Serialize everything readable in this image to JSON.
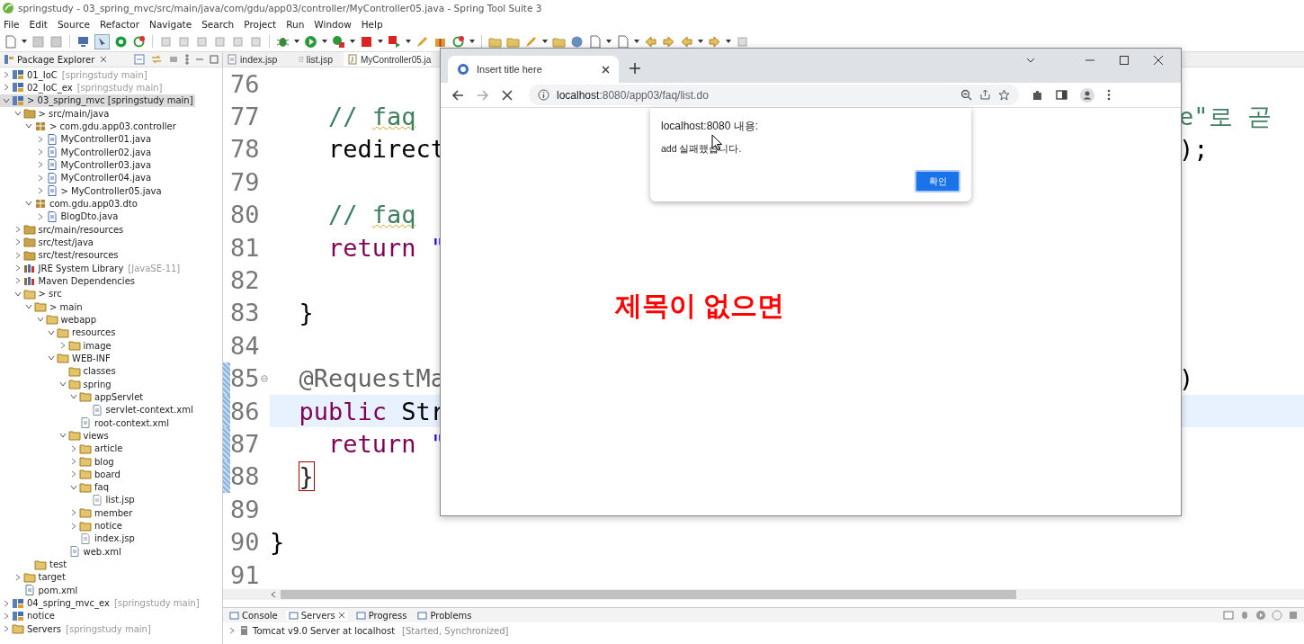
{
  "window": {
    "title": "springstudy - 03_spring_mvc/src/main/java/com/gdu/app03/controller/MyController05.java - Spring Tool Suite 3"
  },
  "menu": [
    "File",
    "Edit",
    "Source",
    "Refactor",
    "Navigate",
    "Search",
    "Project",
    "Run",
    "Window",
    "Help"
  ],
  "explorer": {
    "title": "Package Explorer",
    "tree": [
      {
        "label": "01_IoC",
        "tag": "[springstudy main]",
        "kind": "project",
        "expandable": true,
        "expanded": false,
        "selected": false
      },
      {
        "label": "02_IoC_ex",
        "tag": "[springstudy main]",
        "kind": "project",
        "expandable": true,
        "expanded": false,
        "selected": false
      },
      {
        "label": "> 03_spring_mvc [springstudy main]",
        "kind": "project",
        "expandable": true,
        "expanded": true,
        "selected": true,
        "children": [
          {
            "label": "> src/main/java",
            "kind": "source-folder",
            "expandable": true,
            "expanded": true,
            "selected": false,
            "children": [
              {
                "label": "> com.gdu.app03.controller",
                "kind": "package",
                "expandable": true,
                "expanded": true,
                "selected": false,
                "children": [
                  {
                    "label": "MyController01.java",
                    "kind": "java-file",
                    "expandable": true,
                    "expanded": false,
                    "selected": false
                  },
                  {
                    "label": "MyController02.java",
                    "kind": "java-file",
                    "expandable": true,
                    "expanded": false,
                    "selected": false
                  },
                  {
                    "label": "MyController03.java",
                    "kind": "java-file",
                    "expandable": true,
                    "expanded": false,
                    "selected": false
                  },
                  {
                    "label": "MyController04.java",
                    "kind": "java-file",
                    "expandable": true,
                    "expanded": false,
                    "selected": false
                  },
                  {
                    "label": "> MyController05.java",
                    "kind": "java-file",
                    "expandable": true,
                    "expanded": false,
                    "selected": false
                  }
                ]
              },
              {
                "label": "com.gdu.app03.dto",
                "kind": "package",
                "expandable": true,
                "expanded": true,
                "selected": false,
                "children": [
                  {
                    "label": "BlogDto.java",
                    "kind": "java-file",
                    "expandable": true,
                    "expanded": false,
                    "selected": false
                  }
                ]
              }
            ]
          },
          {
            "label": "src/main/resources",
            "kind": "source-folder",
            "expandable": true,
            "expanded": false,
            "selected": false
          },
          {
            "label": "src/test/java",
            "kind": "source-folder",
            "expandable": true,
            "expanded": false,
            "selected": false
          },
          {
            "label": "src/test/resources",
            "kind": "source-folder",
            "expandable": true,
            "expanded": false,
            "selected": false
          },
          {
            "label": "JRE System Library",
            "tag": "[JavaSE-11]",
            "kind": "library",
            "expandable": true,
            "expanded": false,
            "selected": false
          },
          {
            "label": "Maven Dependencies",
            "kind": "library",
            "expandable": true,
            "expanded": false,
            "selected": false
          },
          {
            "label": "> src",
            "kind": "folder",
            "expandable": true,
            "expanded": true,
            "selected": false,
            "children": [
              {
                "label": "> main",
                "kind": "folder",
                "expandable": true,
                "expanded": true,
                "selected": false,
                "children": [
                  {
                    "label": "webapp",
                    "kind": "folder",
                    "expandable": true,
                    "expanded": true,
                    "selected": false,
                    "children": [
                      {
                        "label": "resources",
                        "kind": "folder",
                        "expandable": true,
                        "expanded": true,
                        "selected": false,
                        "children": [
                          {
                            "label": "image",
                            "kind": "folder",
                            "expandable": true,
                            "expanded": false,
                            "selected": false
                          }
                        ]
                      },
                      {
                        "label": "WEB-INF",
                        "kind": "folder",
                        "expandable": true,
                        "expanded": true,
                        "selected": false,
                        "children": [
                          {
                            "label": "classes",
                            "kind": "folder",
                            "expandable": false,
                            "selected": false
                          },
                          {
                            "label": "spring",
                            "kind": "folder",
                            "expandable": true,
                            "expanded": true,
                            "selected": false,
                            "children": [
                              {
                                "label": "appServlet",
                                "kind": "folder",
                                "expandable": true,
                                "expanded": true,
                                "selected": false,
                                "children": [
                                  {
                                    "label": "servlet-context.xml",
                                    "kind": "xml-file",
                                    "expandable": false,
                                    "selected": false
                                  }
                                ]
                              },
                              {
                                "label": "root-context.xml",
                                "kind": "xml-file",
                                "expandable": false,
                                "selected": false
                              }
                            ]
                          },
                          {
                            "label": "views",
                            "kind": "folder",
                            "expandable": true,
                            "expanded": true,
                            "selected": false,
                            "children": [
                              {
                                "label": "article",
                                "kind": "folder",
                                "expandable": true,
                                "expanded": false,
                                "selected": false
                              },
                              {
                                "label": "blog",
                                "kind": "folder",
                                "expandable": true,
                                "expanded": false,
                                "selected": false
                              },
                              {
                                "label": "board",
                                "kind": "folder",
                                "expandable": true,
                                "expanded": false,
                                "selected": false
                              },
                              {
                                "label": "faq",
                                "kind": "folder",
                                "expandable": true,
                                "expanded": true,
                                "selected": false,
                                "children": [
                                  {
                                    "label": "list.jsp",
                                    "kind": "jsp-file",
                                    "expandable": false,
                                    "selected": false
                                  }
                                ]
                              },
                              {
                                "label": "member",
                                "kind": "folder",
                                "expandable": true,
                                "expanded": false,
                                "selected": false
                              },
                              {
                                "label": "notice",
                                "kind": "folder",
                                "expandable": true,
                                "expanded": false,
                                "selected": false
                              },
                              {
                                "label": "index.jsp",
                                "kind": "jsp-file",
                                "expandable": false,
                                "selected": false
                              }
                            ]
                          },
                          {
                            "label": "web.xml",
                            "kind": "xml-file",
                            "expandable": false,
                            "selected": false
                          }
                        ]
                      }
                    ]
                  }
                ]
              },
              {
                "label": "test",
                "kind": "folder",
                "expandable": false,
                "selected": false
              }
            ]
          },
          {
            "label": "target",
            "kind": "folder",
            "expandable": true,
            "expanded": false,
            "selected": false
          },
          {
            "label": "pom.xml",
            "kind": "pom-file",
            "expandable": false,
            "selected": false
          }
        ]
      },
      {
        "label": "04_spring_mvc_ex",
        "tag": "[springstudy main]",
        "kind": "project",
        "expandable": true,
        "expanded": false,
        "selected": false
      },
      {
        "label": "notice",
        "kind": "project",
        "expandable": true,
        "expanded": false,
        "selected": false
      },
      {
        "label": "Servers",
        "tag": "[springstudy main]",
        "kind": "folder",
        "expandable": true,
        "expanded": false,
        "selected": false
      }
    ]
  },
  "editor": {
    "tabs": [
      {
        "label": "index.jsp",
        "kind": "jsp",
        "selected": false
      },
      {
        "label": "list.jsp",
        "kind": "jsp",
        "selected": false
      },
      {
        "label": "MyController05.ja",
        "kind": "java",
        "selected": true
      }
    ],
    "lines": [
      {
        "number": "76",
        "current": false,
        "changed": false
      },
      {
        "number": "77",
        "current": false,
        "changed": false,
        "code": [
          {
            "kind": "comment",
            "text": "    // "
          },
          {
            "kind": "flagged",
            "text": "faq"
          }
        ],
        "right": [
          {
            "kind": "comment",
            "text": "e\"로 곧"
          }
        ]
      },
      {
        "number": "78",
        "current": false,
        "changed": false,
        "code": [
          {
            "kind": "plain",
            "text": "    redirect"
          }
        ],
        "right": [
          {
            "kind": "plain",
            "text": ");"
          }
        ]
      },
      {
        "number": "79",
        "current": false,
        "changed": false
      },
      {
        "number": "80",
        "current": false,
        "changed": false,
        "code": [
          {
            "kind": "comment",
            "text": "    // "
          },
          {
            "kind": "flagged",
            "text": "faq"
          }
        ]
      },
      {
        "number": "81",
        "current": false,
        "changed": false,
        "code": [
          {
            "kind": "keyword",
            "text": "    return "
          },
          {
            "kind": "string",
            "text": "\""
          }
        ]
      },
      {
        "number": "82",
        "current": false,
        "changed": false
      },
      {
        "number": "83",
        "current": false,
        "changed": false,
        "code": [
          {
            "kind": "plain",
            "text": "  }"
          }
        ]
      },
      {
        "number": "84",
        "current": false,
        "changed": false
      },
      {
        "number": "85",
        "current": false,
        "changed": true,
        "fold": true,
        "code": [
          {
            "kind": "annotation",
            "text": "  @RequestMa"
          }
        ],
        "right": [
          {
            "kind": "plain",
            "text": ")"
          }
        ]
      },
      {
        "number": "86",
        "current": true,
        "changed": true,
        "code": [
          {
            "kind": "keyword",
            "text": "  public "
          },
          {
            "kind": "plain",
            "text": "Str"
          }
        ]
      },
      {
        "number": "87",
        "current": false,
        "changed": true,
        "code": [
          {
            "kind": "keyword",
            "text": "    return "
          },
          {
            "kind": "string",
            "text": "\""
          }
        ]
      },
      {
        "number": "88",
        "current": false,
        "changed": true,
        "code": [
          {
            "kind": "match",
            "text": "  }"
          }
        ]
      },
      {
        "number": "89",
        "current": false,
        "changed": false
      },
      {
        "number": "90",
        "current": false,
        "changed": false,
        "code": [
          {
            "kind": "plain",
            "text": "}"
          }
        ]
      },
      {
        "number": "91",
        "current": false,
        "changed": false
      }
    ]
  },
  "browser": {
    "tab_title": "Insert title here",
    "url_host": "localhost",
    "url_path": ":8080/app03/faq/list.do",
    "alert": {
      "title": "localhost:8080 내용:",
      "message": "add 실패했습니다.",
      "button": "확인"
    },
    "page_text": "제목이 없으면"
  },
  "bottom_panel": {
    "tabs": [
      {
        "label": "Console",
        "selected": false
      },
      {
        "label": "Servers",
        "selected": true
      },
      {
        "label": "Progress",
        "selected": false
      },
      {
        "label": "Problems",
        "selected": false
      }
    ],
    "server": {
      "name": "Tomcat v9.0 Server at localhost",
      "status": "[Started, Synchronized]"
    }
  }
}
